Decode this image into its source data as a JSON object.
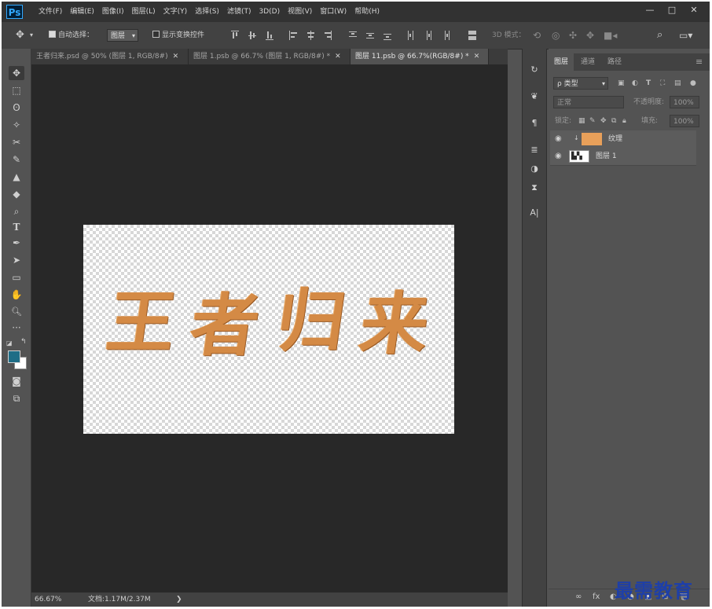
{
  "app": {
    "logo": "Ps"
  },
  "menu": [
    "文件(F)",
    "编辑(E)",
    "图像(I)",
    "图层(L)",
    "文字(Y)",
    "选择(S)",
    "滤镜(T)",
    "3D(D)",
    "视图(V)",
    "窗口(W)",
    "帮助(H)"
  ],
  "window_controls": {
    "minimize": "—",
    "restore": "□",
    "close": "✕"
  },
  "options": {
    "move_icon": "✥",
    "auto_select_label": "自动选择：",
    "auto_select_checked": true,
    "target_value": "图层",
    "show_transform_label": "显示变换控件",
    "show_transform_checked": false,
    "mode_3d": "3D 模式：",
    "search_icon": "search-icon",
    "workspace_icon": "workspace-icon"
  },
  "tabs": [
    {
      "label": "王者归来.psd @ 50% (图层 1, RGB/8#)",
      "close": "✕"
    },
    {
      "label": "图层 1.psb @ 66.7% (图层 1, RGB/8#) *",
      "close": "✕"
    },
    {
      "label": "图层 11.psb @ 66.7%(RGB/8#) *",
      "close": "✕"
    }
  ],
  "tools": [
    {
      "name": "move-tool",
      "glyph": "✥"
    },
    {
      "name": "marquee-tool",
      "glyph": "⬚"
    },
    {
      "name": "lasso-tool",
      "glyph": "ʘ"
    },
    {
      "name": "magic-wand-tool",
      "glyph": "✧"
    },
    {
      "name": "crop-tool",
      "glyph": "✂"
    },
    {
      "name": "brush-tool",
      "glyph": "✎"
    },
    {
      "name": "stamp-tool",
      "glyph": "▲"
    },
    {
      "name": "eraser-tool",
      "glyph": "◆"
    },
    {
      "name": "dodge-tool",
      "glyph": "⌕"
    },
    {
      "name": "type-tool",
      "glyph": "T"
    },
    {
      "name": "pen-tool",
      "glyph": "✒"
    },
    {
      "name": "path-select-tool",
      "glyph": "➤"
    },
    {
      "name": "shape-tool",
      "glyph": "▭"
    },
    {
      "name": "hand-tool",
      "glyph": "✋"
    },
    {
      "name": "zoom-tool",
      "glyph": "🔍︎"
    },
    {
      "name": "more-tools",
      "glyph": "···"
    }
  ],
  "colors": {
    "foreground": "#1f6d86",
    "background": "#ffffff",
    "art": "#d48a45"
  },
  "canvas_text": [
    "王",
    "者",
    "归",
    "来"
  ],
  "status": {
    "zoom": "66.67%",
    "doc_size": "文档:1.17M/2.37M",
    "arrow": "❯"
  },
  "panel_strip": [
    "history-icon",
    "brushes-icon",
    "paragraph-icon",
    "adjust-icon",
    "styles-icon",
    "info-icon",
    "character-icon"
  ],
  "layers_panel": {
    "tabs": [
      "图层",
      "通道",
      "路径"
    ],
    "menu_glyph": "≡",
    "kind": "ρ 类型",
    "blend_mode": "正常",
    "opacity_label": "不透明度:",
    "opacity": "100%",
    "lock_label": "锁定:",
    "fill_label": "填充:",
    "fill": "100%",
    "layers": [
      {
        "name": "纹理",
        "thumb": "#e8a05a"
      },
      {
        "name": "图层 1",
        "thumb": "#2a2a2a"
      }
    ],
    "bottom_icons": [
      "∞",
      "fx",
      "◐",
      "◑",
      "▣",
      "⊞",
      "🗑︎"
    ]
  },
  "watermark": "最需教育"
}
